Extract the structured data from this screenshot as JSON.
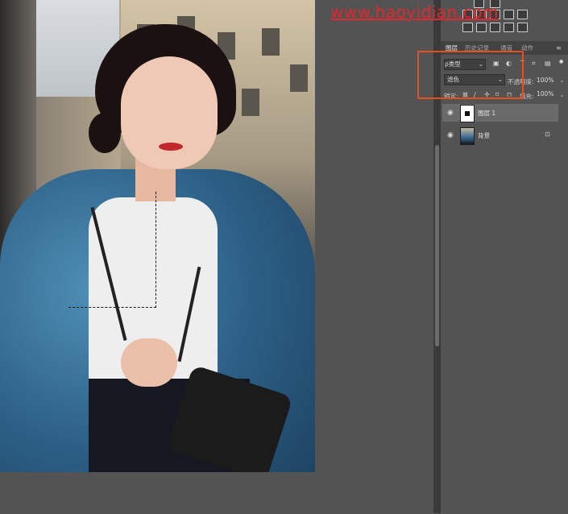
{
  "watermark": "www.haoyidian.com",
  "panel_tabs": [
    "图层",
    "历史记录",
    "通道",
    "动作"
  ],
  "layers_panel": {
    "filter_type": "ρ类型",
    "blend_mode": "滤色",
    "opacity_label": "不透明度:",
    "opacity_value": "100%",
    "lock_label": "锁定:",
    "fill_label": "填充:",
    "fill_value": "100%"
  },
  "layers": [
    {
      "name": "图层 1",
      "visible": true,
      "selected": true
    },
    {
      "name": "背景",
      "visible": true,
      "locked": true
    }
  ],
  "icons": {
    "eye": "👁",
    "lock": "🔒",
    "menu": "≡",
    "dropdown": "⌄",
    "text": "T"
  },
  "colors": {
    "highlight": "#e5501f",
    "watermark": "#e3262b",
    "panel_bg": "#535353"
  }
}
